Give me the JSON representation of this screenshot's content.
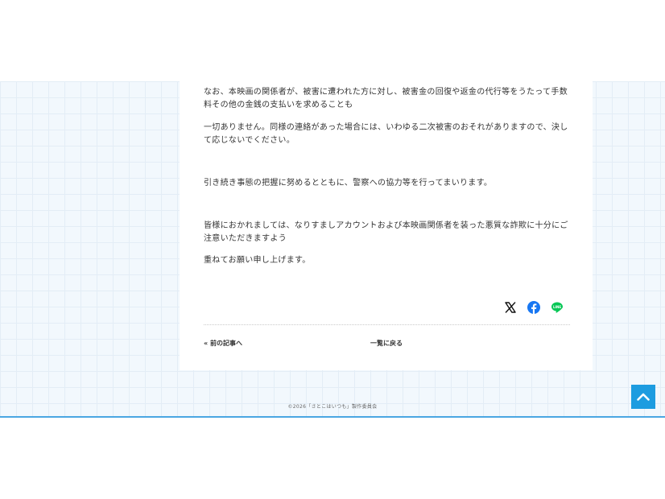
{
  "article": {
    "paragraphs": [
      "なお、本映画の関係者が、被害に遭われた方に対し、被害金の回復や返金の代行等をうたって手数料その他の金銭の支払いを求めることも",
      "一切ありません。同様の連絡があった場合には、いわゆる二次被害のおそれがありますので、決して応じないでください。",
      "引き続き事態の把握に努めるとともに、警察への協力等を行ってまいります。",
      "皆様におかれましては、なりすましアカウントおよび本映画関係者を装った悪質な詐欺に十分にご注意いただきますよう",
      "重ねてお願い申し上げます。"
    ]
  },
  "share": {
    "x_icon": "x-logo-icon",
    "facebook_icon": "facebook-icon",
    "line_icon": "line-icon",
    "line_label": "LINE",
    "colors": {
      "x": "#111111",
      "facebook": "#1877f2",
      "line": "#06c755"
    }
  },
  "nav": {
    "prev_arrow": "«",
    "prev_label": "前の記事へ",
    "back_label": "一覧に戻る"
  },
  "footer": {
    "copyright": "©2026「さとこはいつも」製作委員会"
  },
  "scroll_top": {
    "icon": "chevron-up-icon",
    "color": "#1d9ce0"
  }
}
